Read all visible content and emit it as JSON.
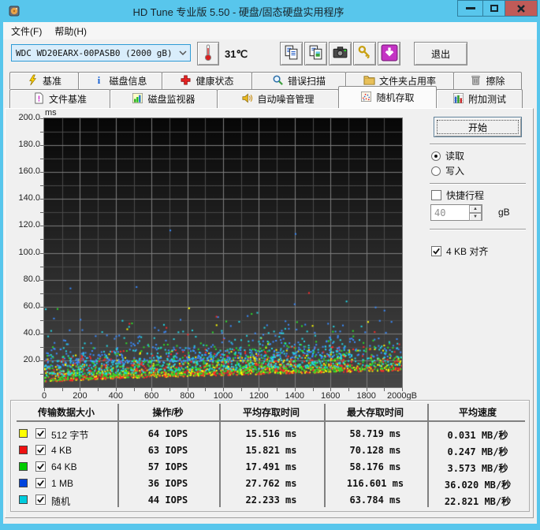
{
  "window": {
    "title": "HD Tune 专业版 5.50 - 硬盘/固态硬盘实用程序"
  },
  "menu": {
    "items": [
      "文件(F)",
      "帮助(H)"
    ]
  },
  "toolbar": {
    "drive_selector": {
      "value": "WDC WD20EARX-00PASB0 (2000 gB)"
    },
    "temperature": "31℃",
    "button_icons": [
      "copy-text-icon",
      "copy-image-icon",
      "camera-icon",
      "keys-icon",
      "save-download-icon"
    ],
    "exit_label": "退出"
  },
  "tabs": {
    "row1": [
      {
        "label": "基准",
        "icon": "benchmark"
      },
      {
        "label": "磁盘信息",
        "icon": "disk-info"
      },
      {
        "label": "健康状态",
        "icon": "health"
      },
      {
        "label": "错误扫描",
        "icon": "error-scan"
      },
      {
        "label": "文件夹占用率",
        "icon": "folder-usage"
      },
      {
        "label": "擦除",
        "icon": "erase"
      }
    ],
    "row2": [
      {
        "label": "文件基准",
        "icon": "file-benchmark"
      },
      {
        "label": "磁盘监视器",
        "icon": "disk-monitor"
      },
      {
        "label": "自动噪音管理",
        "icon": "aam"
      },
      {
        "label": "随机存取",
        "icon": "random-access",
        "active": true
      },
      {
        "label": "附加测试",
        "icon": "extra-tests"
      }
    ]
  },
  "panel": {
    "start_label": "开始",
    "mode": {
      "read_label": "读取",
      "write_label": "写入",
      "selected": "read"
    },
    "short_stroke": {
      "label": "快捷行程",
      "checked": false,
      "value": "40",
      "unit": "gB"
    },
    "align": {
      "label": "4 KB 对齐",
      "checked": true
    }
  },
  "chart_data": {
    "type": "scatter",
    "xlabel": "gB",
    "ylabel": "ms",
    "xlim": [
      0,
      2000
    ],
    "ylim": [
      0,
      200
    ],
    "x_tick_labels": [
      "0",
      "200",
      "400",
      "600",
      "800",
      "1000",
      "1200",
      "1400",
      "1600",
      "1800",
      "2000gB"
    ],
    "y_tick_labels": [
      "20.0",
      "40.0",
      "60.0",
      "80.0",
      "100.0",
      "120.0",
      "140.0",
      "160.0",
      "180.0",
      "200.0"
    ],
    "grid": {
      "x_minor": 100,
      "x_major": 200,
      "y_minor": 10,
      "y_major": 20
    },
    "plot_background": {
      "top": "#070707",
      "bottom": "#474747"
    },
    "grid_colors": {
      "minor": "#4a4a4a",
      "major": "#7d7d7d"
    },
    "envelope_min_ms": {
      "at_0": 3.2,
      "at_2000": 12.0,
      "exponent": 0.72
    },
    "series": [
      {
        "name": "512 字节",
        "color": "#ffff00",
        "stats": {
          "iops": 64,
          "avg_ms": 15.516,
          "max_ms": 58.719,
          "speed_MB_s": 0.031
        },
        "scatter": {
          "count": 600,
          "base": 0.3,
          "mean": 5.5,
          "cap": 20,
          "outliers": 6,
          "out_lo": 28,
          "out_hi": 50
        },
        "max_point": {
          "x": 810,
          "y": 58.7
        }
      },
      {
        "name": "4 KB",
        "color": "#ff2a2a",
        "stats": {
          "iops": 63,
          "avg_ms": 15.821,
          "max_ms": 70.128,
          "speed_MB_s": 0.247
        },
        "scatter": {
          "count": 600,
          "base": 0.3,
          "mean": 6.0,
          "cap": 21,
          "outliers": 6,
          "out_lo": 28,
          "out_hi": 56
        },
        "max_point": {
          "x": 1480,
          "y": 70.1
        }
      },
      {
        "name": "64 KB",
        "color": "#2ae02a",
        "stats": {
          "iops": 57,
          "avg_ms": 17.491,
          "max_ms": 58.176,
          "speed_MB_s": 3.573
        },
        "scatter": {
          "count": 600,
          "base": 0.8,
          "mean": 7.5,
          "cap": 26,
          "outliers": 8,
          "out_lo": 30,
          "out_hi": 55
        },
        "max_point": {
          "x": 75,
          "y": 58.2
        }
      },
      {
        "name": "1 MB",
        "color": "#3a8cff",
        "stats": {
          "iops": 36,
          "avg_ms": 27.762,
          "max_ms": 116.601,
          "speed_MB_s": 36.02
        },
        "scatter": {
          "count": 430,
          "base": 11,
          "mean": 7,
          "cap": 38,
          "outliers": 10,
          "out_lo": 40,
          "out_hi": 75
        },
        "max_point": {
          "x": 705,
          "y": 116.6
        },
        "extra_points": [
          {
            "x": 1405,
            "y": 114.0
          }
        ]
      },
      {
        "name": "随机",
        "color": "#22d8e8",
        "stats": {
          "iops": 44,
          "avg_ms": 22.233,
          "max_ms": 63.784,
          "speed_MB_s": 22.821
        },
        "scatter": {
          "count": 520,
          "base": 4,
          "mean": 8,
          "cap": 36,
          "outliers": 8,
          "out_lo": 38,
          "out_hi": 60
        },
        "max_point": {
          "x": 1690,
          "y": 63.8
        }
      }
    ]
  },
  "table": {
    "headers": [
      "传输数据大小",
      "操作/秒",
      "平均存取时间",
      "最大存取时间",
      "平均速度"
    ],
    "rows": [
      {
        "label": "512 字节",
        "color": "#ffff00",
        "checked": true,
        "iops": "64 IOPS",
        "avg": "15.516 ms",
        "max": "58.719 ms",
        "speed": "0.031 MB/秒"
      },
      {
        "label": "4 KB",
        "color": "#ee1111",
        "checked": true,
        "iops": "63 IOPS",
        "avg": "15.821 ms",
        "max": "70.128 ms",
        "speed": "0.247 MB/秒"
      },
      {
        "label": "64 KB",
        "color": "#00cc00",
        "checked": true,
        "iops": "57 IOPS",
        "avg": "17.491 ms",
        "max": "58.176 ms",
        "speed": "3.573 MB/秒"
      },
      {
        "label": "1 MB",
        "color": "#0044dd",
        "checked": true,
        "iops": "36 IOPS",
        "avg": "27.762 ms",
        "max": "116.601 ms",
        "speed": "36.020 MB/秒"
      },
      {
        "label": "随机",
        "color": "#00ccdd",
        "checked": true,
        "iops": "44 IOPS",
        "avg": "22.233 ms",
        "max": "63.784 ms",
        "speed": "22.821 MB/秒"
      }
    ]
  }
}
